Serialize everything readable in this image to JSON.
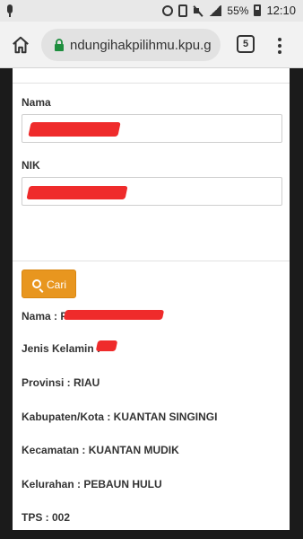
{
  "status_bar": {
    "battery": "55%",
    "time": "12:10",
    "icons": [
      "mic-icon",
      "alarm-icon",
      "vibrate-icon",
      "mute-icon",
      "signal-icon",
      "battery-icon"
    ]
  },
  "browser": {
    "url": "ndungihakpilihmu.kpu.g",
    "tab_count": "5",
    "icons": [
      "home-icon",
      "lock-icon",
      "tabs-icon",
      "menu-icon"
    ]
  },
  "form": {
    "nama_label": "Nama",
    "nik_label": "NIK",
    "search_button": "Cari"
  },
  "result": {
    "nama": "Nama : P",
    "jenis_kelamin": "Jenis Kelamin :",
    "provinsi": "Provinsi : RIAU",
    "kabupaten": "Kabupaten/Kota : KUANTAN SINGINGI",
    "kecamatan": "Kecamatan : KUANTAN MUDIK",
    "kelurahan": "Kelurahan : PEBAUN HULU",
    "tps": "TPS : 002"
  },
  "colors": {
    "accent_button": "#e8961f",
    "redaction": "#ef2b2b",
    "secure_lock": "#1e8e3e"
  }
}
